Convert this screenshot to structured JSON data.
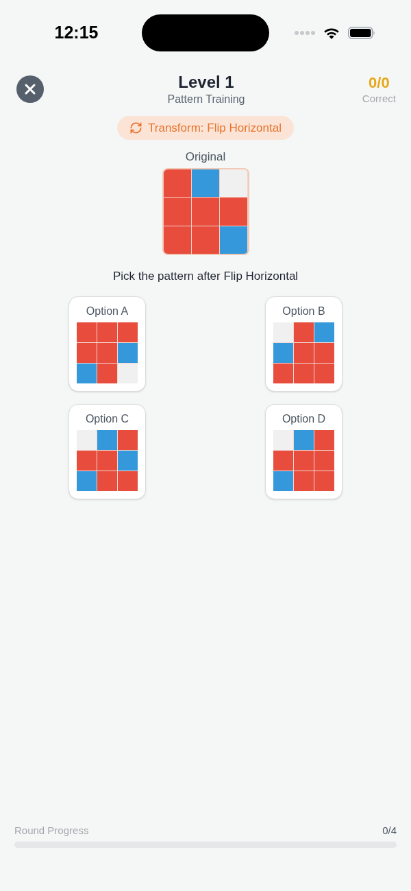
{
  "status_bar": {
    "time": "12:15"
  },
  "header": {
    "title": "Level 1",
    "subtitle": "Pattern Training",
    "score": "0/0",
    "score_label": "Correct"
  },
  "transform": {
    "label": "Transform: Flip Horizontal"
  },
  "original": {
    "label": "Original",
    "cells": [
      {
        "color": "#e74c3c"
      },
      {
        "color": "#3498db"
      },
      {
        "color": "#f0f0f0"
      },
      {
        "color": "#e74c3c"
      },
      {
        "color": "#e74c3c"
      },
      {
        "color": "#e74c3c"
      },
      {
        "color": "#e74c3c"
      },
      {
        "color": "#e74c3c"
      },
      {
        "color": "#3498db"
      }
    ]
  },
  "prompt": "Pick the pattern after Flip Horizontal",
  "options": [
    {
      "label": "Option A",
      "cells": [
        {
          "color": "#e74c3c"
        },
        {
          "color": "#e74c3c"
        },
        {
          "color": "#e74c3c"
        },
        {
          "color": "#e74c3c"
        },
        {
          "color": "#e74c3c"
        },
        {
          "color": "#3498db"
        },
        {
          "color": "#3498db"
        },
        {
          "color": "#e74c3c"
        },
        {
          "color": "#f0f0f0"
        }
      ]
    },
    {
      "label": "Option B",
      "cells": [
        {
          "color": "#f0f0f0"
        },
        {
          "color": "#e74c3c"
        },
        {
          "color": "#3498db"
        },
        {
          "color": "#3498db"
        },
        {
          "color": "#e74c3c"
        },
        {
          "color": "#e74c3c"
        },
        {
          "color": "#e74c3c"
        },
        {
          "color": "#e74c3c"
        },
        {
          "color": "#e74c3c"
        }
      ]
    },
    {
      "label": "Option C",
      "cells": [
        {
          "color": "#f0f0f0"
        },
        {
          "color": "#3498db"
        },
        {
          "color": "#e74c3c"
        },
        {
          "color": "#e74c3c"
        },
        {
          "color": "#e74c3c"
        },
        {
          "color": "#3498db"
        },
        {
          "color": "#3498db"
        },
        {
          "color": "#e74c3c"
        },
        {
          "color": "#e74c3c"
        }
      ]
    },
    {
      "label": "Option D",
      "cells": [
        {
          "color": "#f0f0f0"
        },
        {
          "color": "#3498db"
        },
        {
          "color": "#e74c3c"
        },
        {
          "color": "#e74c3c"
        },
        {
          "color": "#e74c3c"
        },
        {
          "color": "#e74c3c"
        },
        {
          "color": "#3498db"
        },
        {
          "color": "#e74c3c"
        },
        {
          "color": "#e74c3c"
        }
      ]
    }
  ],
  "progress": {
    "label": "Round Progress",
    "count": "0/4",
    "level": 0
  }
}
